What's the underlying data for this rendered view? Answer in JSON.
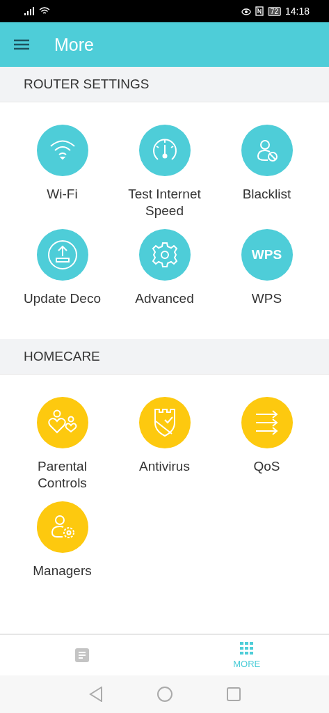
{
  "status_bar": {
    "battery": "72",
    "time": "14:18"
  },
  "header": {
    "title": "More"
  },
  "sections": [
    {
      "title": "ROUTER SETTINGS",
      "kind": "router",
      "items": [
        {
          "label": "Wi-Fi",
          "kind": "wifi"
        },
        {
          "label": "Test Internet Speed",
          "kind": "gauge"
        },
        {
          "label": "Blacklist",
          "kind": "block"
        },
        {
          "label": "Update Deco",
          "kind": "upload"
        },
        {
          "label": "Advanced",
          "kind": "gear"
        },
        {
          "label": "WPS",
          "kind": "text",
          "icon_text": "WPS"
        }
      ]
    },
    {
      "title": "HOMECARE",
      "kind": "homecare",
      "items": [
        {
          "label": "Parental Controls",
          "kind": "family"
        },
        {
          "label": "Antivirus",
          "kind": "shield"
        },
        {
          "label": "QoS",
          "kind": "arrows"
        },
        {
          "label": "Managers",
          "kind": "managers"
        }
      ]
    }
  ],
  "bottom_nav": [
    {
      "kind": "document",
      "selected": false
    },
    {
      "kind": "grid",
      "label": "MORE",
      "selected": true
    }
  ]
}
